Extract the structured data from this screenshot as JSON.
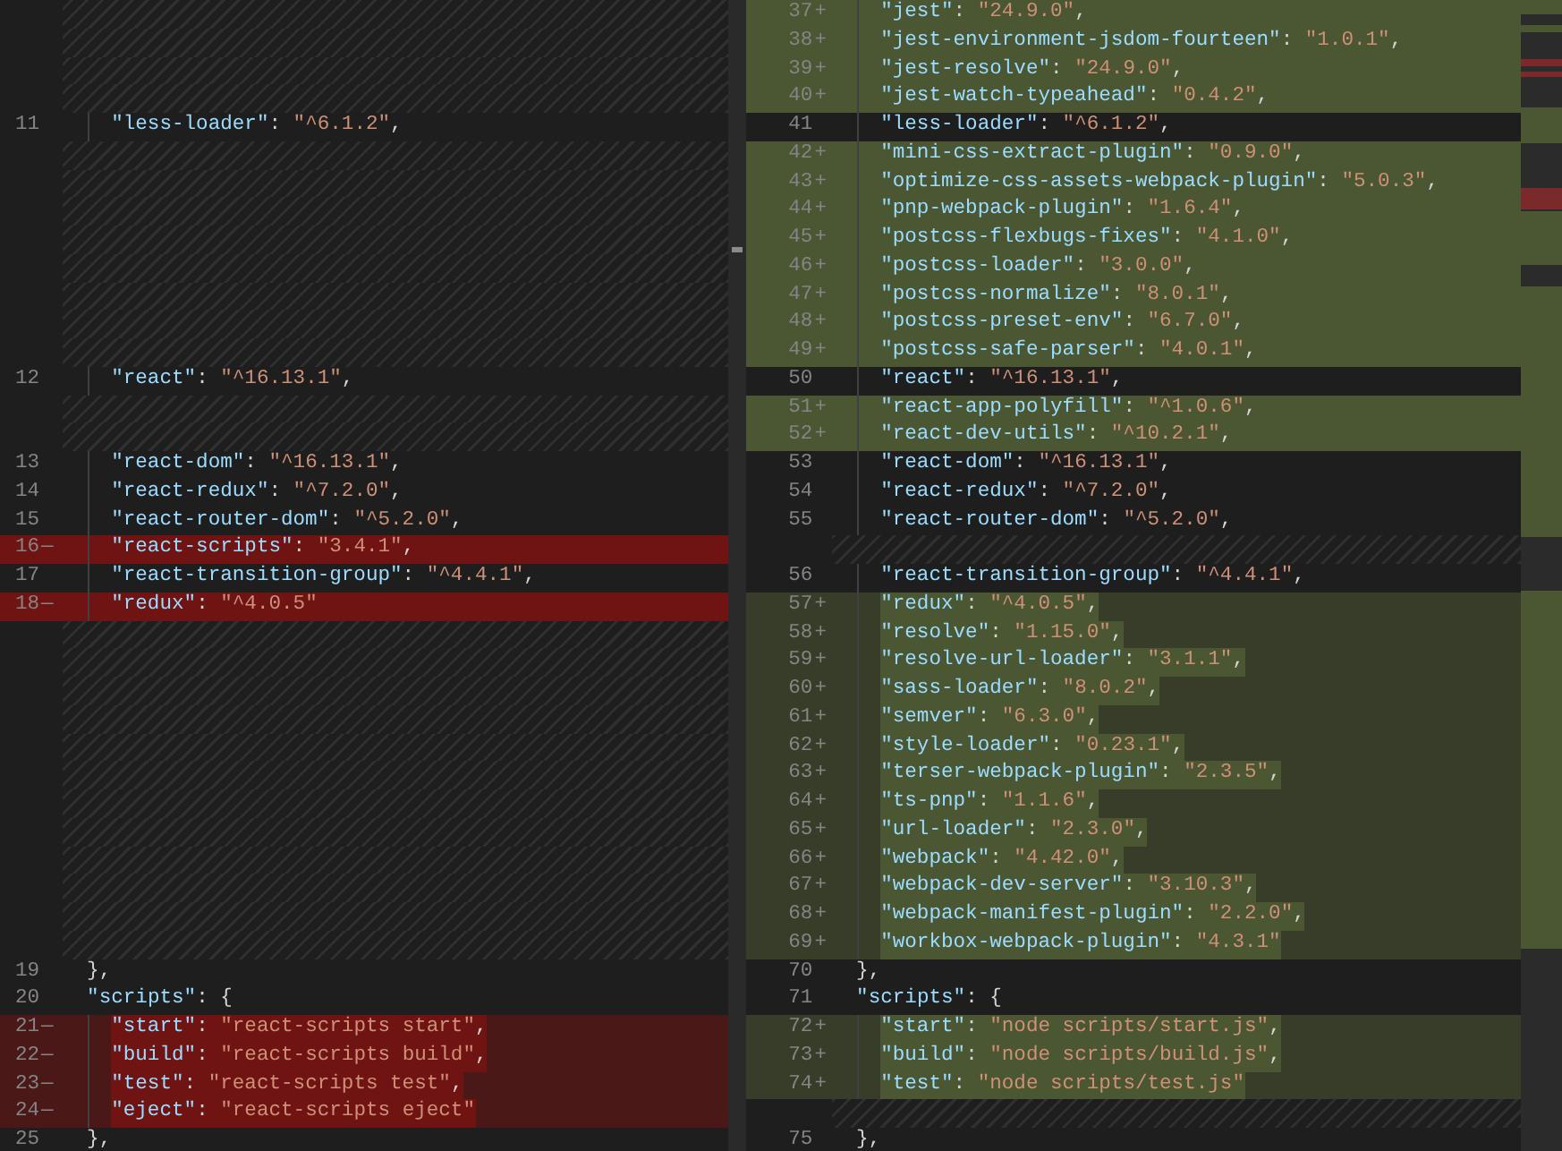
{
  "original_pane": {
    "lines": [
      {
        "kind": "gap"
      },
      {
        "kind": "gap"
      },
      {
        "kind": "gap"
      },
      {
        "kind": "gap"
      },
      {
        "kind": "unchanged",
        "num": "11",
        "key": "\"less-loader\"",
        "sep": ": ",
        "value": "\"^6.1.2\"",
        "end": ","
      },
      {
        "kind": "gap"
      },
      {
        "kind": "gap"
      },
      {
        "kind": "gap"
      },
      {
        "kind": "gap"
      },
      {
        "kind": "gap"
      },
      {
        "kind": "gap"
      },
      {
        "kind": "gap"
      },
      {
        "kind": "gap"
      },
      {
        "kind": "unchanged",
        "num": "12",
        "key": "\"react\"",
        "sep": ": ",
        "value": "\"^16.13.1\"",
        "end": ","
      },
      {
        "kind": "gap"
      },
      {
        "kind": "gap"
      },
      {
        "kind": "unchanged",
        "num": "13",
        "key": "\"react-dom\"",
        "sep": ": ",
        "value": "\"^16.13.1\"",
        "end": ","
      },
      {
        "kind": "unchanged",
        "num": "14",
        "key": "\"react-redux\"",
        "sep": ": ",
        "value": "\"^7.2.0\"",
        "end": ","
      },
      {
        "kind": "unchanged",
        "num": "15",
        "key": "\"react-router-dom\"",
        "sep": ": ",
        "value": "\"^5.2.0\"",
        "end": ","
      },
      {
        "kind": "removed",
        "num": "16",
        "sign": "—",
        "inline": false,
        "key": "\"react-scripts\"",
        "sep": ": ",
        "value": "\"3.4.1\"",
        "end": ","
      },
      {
        "kind": "unchanged",
        "num": "17",
        "key": "\"react-transition-group\"",
        "sep": ": ",
        "value": "\"^4.4.1\"",
        "end": ","
      },
      {
        "kind": "removed",
        "num": "18",
        "sign": "—",
        "inline": false,
        "key": "\"redux\"",
        "sep": ": ",
        "value": "\"^4.0.5\""
      },
      {
        "kind": "gap"
      },
      {
        "kind": "gap"
      },
      {
        "kind": "gap"
      },
      {
        "kind": "gap"
      },
      {
        "kind": "gap"
      },
      {
        "kind": "gap"
      },
      {
        "kind": "gap"
      },
      {
        "kind": "gap"
      },
      {
        "kind": "gap"
      },
      {
        "kind": "gap"
      },
      {
        "kind": "gap"
      },
      {
        "kind": "gap"
      },
      {
        "kind": "unchanged",
        "num": "19",
        "outer": true,
        "end": "},"
      },
      {
        "kind": "unchanged",
        "num": "20",
        "outer": true,
        "key": "\"scripts\"",
        "sep": ": ",
        "end": "{"
      },
      {
        "kind": "removed",
        "num": "21",
        "sign": "—",
        "inline": true,
        "key": "\"start\"",
        "sep": ": ",
        "value": "\"react-scripts start\"",
        "end": ","
      },
      {
        "kind": "removed",
        "num": "22",
        "sign": "—",
        "inline": true,
        "key": "\"build\"",
        "sep": ": ",
        "value": "\"react-scripts build\"",
        "end": ","
      },
      {
        "kind": "removed",
        "num": "23",
        "sign": "—",
        "inline": true,
        "key": "\"test\"",
        "sep": ": ",
        "value": "\"react-scripts test\"",
        "end": ","
      },
      {
        "kind": "removed",
        "num": "24",
        "sign": "—",
        "inline": true,
        "key": "\"eject\"",
        "sep": ": ",
        "value": "\"react-scripts eject\""
      },
      {
        "kind": "unchanged",
        "num": "25",
        "outer": true,
        "end": "},"
      }
    ]
  },
  "modified_pane": {
    "lines": [
      {
        "kind": "added",
        "num": "37",
        "sign": "+",
        "inline": false,
        "key": "\"jest\"",
        "sep": ": ",
        "value": "\"24.9.0\"",
        "end": ","
      },
      {
        "kind": "added",
        "num": "38",
        "sign": "+",
        "inline": false,
        "key": "\"jest-environment-jsdom-fourteen\"",
        "sep": ": ",
        "value": "\"1.0.1\"",
        "end": ","
      },
      {
        "kind": "added",
        "num": "39",
        "sign": "+",
        "inline": false,
        "key": "\"jest-resolve\"",
        "sep": ": ",
        "value": "\"24.9.0\"",
        "end": ","
      },
      {
        "kind": "added",
        "num": "40",
        "sign": "+",
        "inline": false,
        "key": "\"jest-watch-typeahead\"",
        "sep": ": ",
        "value": "\"0.4.2\"",
        "end": ","
      },
      {
        "kind": "unchanged",
        "num": "41",
        "key": "\"less-loader\"",
        "sep": ": ",
        "value": "\"^6.1.2\"",
        "end": ","
      },
      {
        "kind": "added",
        "num": "42",
        "sign": "+",
        "inline": false,
        "key": "\"mini-css-extract-plugin\"",
        "sep": ": ",
        "value": "\"0.9.0\"",
        "end": ","
      },
      {
        "kind": "added",
        "num": "43",
        "sign": "+",
        "inline": false,
        "key": "\"optimize-css-assets-webpack-plugin\"",
        "sep": ": ",
        "value": "\"5.0.3\"",
        "end": ","
      },
      {
        "kind": "added",
        "num": "44",
        "sign": "+",
        "inline": false,
        "key": "\"pnp-webpack-plugin\"",
        "sep": ": ",
        "value": "\"1.6.4\"",
        "end": ","
      },
      {
        "kind": "added",
        "num": "45",
        "sign": "+",
        "inline": false,
        "key": "\"postcss-flexbugs-fixes\"",
        "sep": ": ",
        "value": "\"4.1.0\"",
        "end": ","
      },
      {
        "kind": "added",
        "num": "46",
        "sign": "+",
        "inline": false,
        "key": "\"postcss-loader\"",
        "sep": ": ",
        "value": "\"3.0.0\"",
        "end": ","
      },
      {
        "kind": "added",
        "num": "47",
        "sign": "+",
        "inline": false,
        "key": "\"postcss-normalize\"",
        "sep": ": ",
        "value": "\"8.0.1\"",
        "end": ","
      },
      {
        "kind": "added",
        "num": "48",
        "sign": "+",
        "inline": false,
        "key": "\"postcss-preset-env\"",
        "sep": ": ",
        "value": "\"6.7.0\"",
        "end": ","
      },
      {
        "kind": "added",
        "num": "49",
        "sign": "+",
        "inline": false,
        "key": "\"postcss-safe-parser\"",
        "sep": ": ",
        "value": "\"4.0.1\"",
        "end": ","
      },
      {
        "kind": "unchanged",
        "num": "50",
        "key": "\"react\"",
        "sep": ": ",
        "value": "\"^16.13.1\"",
        "end": ","
      },
      {
        "kind": "added",
        "num": "51",
        "sign": "+",
        "inline": false,
        "key": "\"react-app-polyfill\"",
        "sep": ": ",
        "value": "\"^1.0.6\"",
        "end": ","
      },
      {
        "kind": "added",
        "num": "52",
        "sign": "+",
        "inline": false,
        "key": "\"react-dev-utils\"",
        "sep": ": ",
        "value": "\"^10.2.1\"",
        "end": ","
      },
      {
        "kind": "unchanged",
        "num": "53",
        "key": "\"react-dom\"",
        "sep": ": ",
        "value": "\"^16.13.1\"",
        "end": ","
      },
      {
        "kind": "unchanged",
        "num": "54",
        "key": "\"react-redux\"",
        "sep": ": ",
        "value": "\"^7.2.0\"",
        "end": ","
      },
      {
        "kind": "unchanged",
        "num": "55",
        "key": "\"react-router-dom\"",
        "sep": ": ",
        "value": "\"^5.2.0\"",
        "end": ","
      },
      {
        "kind": "gap"
      },
      {
        "kind": "unchanged",
        "num": "56",
        "key": "\"react-transition-group\"",
        "sep": ": ",
        "value": "\"^4.4.1\"",
        "end": ","
      },
      {
        "kind": "added",
        "num": "57",
        "sign": "+",
        "inline": true,
        "key": "\"redux\"",
        "sep": ": ",
        "value": "\"^4.0.5\"",
        "end": ","
      },
      {
        "kind": "added",
        "num": "58",
        "sign": "+",
        "inline": true,
        "key": "\"resolve\"",
        "sep": ": ",
        "value": "\"1.15.0\"",
        "end": ","
      },
      {
        "kind": "added",
        "num": "59",
        "sign": "+",
        "inline": true,
        "key": "\"resolve-url-loader\"",
        "sep": ": ",
        "value": "\"3.1.1\"",
        "end": ","
      },
      {
        "kind": "added",
        "num": "60",
        "sign": "+",
        "inline": true,
        "key": "\"sass-loader\"",
        "sep": ": ",
        "value": "\"8.0.2\"",
        "end": ","
      },
      {
        "kind": "added",
        "num": "61",
        "sign": "+",
        "inline": true,
        "key": "\"semver\"",
        "sep": ": ",
        "value": "\"6.3.0\"",
        "end": ","
      },
      {
        "kind": "added",
        "num": "62",
        "sign": "+",
        "inline": true,
        "key": "\"style-loader\"",
        "sep": ": ",
        "value": "\"0.23.1\"",
        "end": ","
      },
      {
        "kind": "added",
        "num": "63",
        "sign": "+",
        "inline": true,
        "key": "\"terser-webpack-plugin\"",
        "sep": ": ",
        "value": "\"2.3.5\"",
        "end": ","
      },
      {
        "kind": "added",
        "num": "64",
        "sign": "+",
        "inline": true,
        "key": "\"ts-pnp\"",
        "sep": ": ",
        "value": "\"1.1.6\"",
        "end": ","
      },
      {
        "kind": "added",
        "num": "65",
        "sign": "+",
        "inline": true,
        "key": "\"url-loader\"",
        "sep": ": ",
        "value": "\"2.3.0\"",
        "end": ","
      },
      {
        "kind": "added",
        "num": "66",
        "sign": "+",
        "inline": true,
        "key": "\"webpack\"",
        "sep": ": ",
        "value": "\"4.42.0\"",
        "end": ","
      },
      {
        "kind": "added",
        "num": "67",
        "sign": "+",
        "inline": true,
        "key": "\"webpack-dev-server\"",
        "sep": ": ",
        "value": "\"3.10.3\"",
        "end": ","
      },
      {
        "kind": "added",
        "num": "68",
        "sign": "+",
        "inline": true,
        "key": "\"webpack-manifest-plugin\"",
        "sep": ": ",
        "value": "\"2.2.0\"",
        "end": ","
      },
      {
        "kind": "added",
        "num": "69",
        "sign": "+",
        "inline": true,
        "key": "\"workbox-webpack-plugin\"",
        "sep": ": ",
        "value": "\"4.3.1\""
      },
      {
        "kind": "unchanged",
        "num": "70",
        "outer": true,
        "end": "},"
      },
      {
        "kind": "unchanged",
        "num": "71",
        "outer": true,
        "key": "\"scripts\"",
        "sep": ": ",
        "end": "{"
      },
      {
        "kind": "added",
        "num": "72",
        "sign": "+",
        "inline": true,
        "key": "\"start\"",
        "sep": ": ",
        "value": "\"node scripts/start.js\"",
        "end": ","
      },
      {
        "kind": "added",
        "num": "73",
        "sign": "+",
        "inline": true,
        "key": "\"build\"",
        "sep": ": ",
        "value": "\"node scripts/build.js\"",
        "end": ","
      },
      {
        "kind": "added",
        "num": "74",
        "sign": "+",
        "inline": true,
        "key": "\"test\"",
        "sep": ": ",
        "value": "\"node scripts/test.js\""
      },
      {
        "kind": "gap"
      },
      {
        "kind": "unchanged",
        "num": "75",
        "outer": true,
        "end": "},"
      }
    ]
  }
}
